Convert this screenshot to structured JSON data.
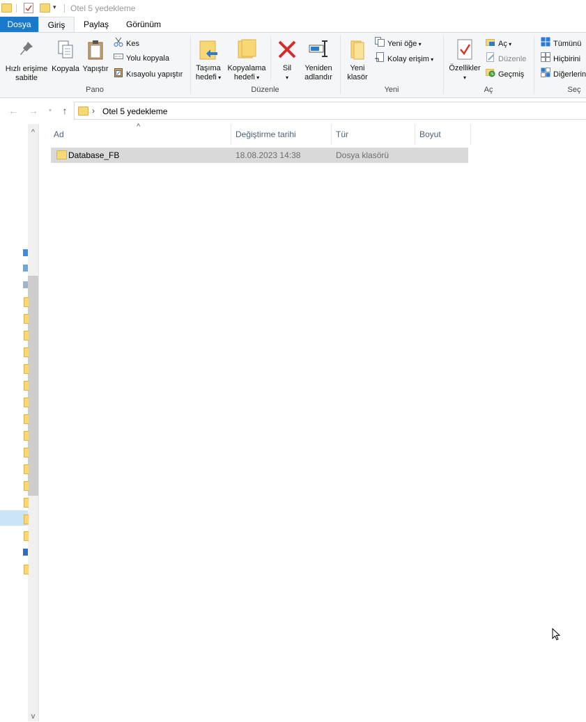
{
  "window": {
    "title": "Otel 5 yedekleme"
  },
  "tabs": [
    "Dosya",
    "Giriş",
    "Paylaş",
    "Görünüm"
  ],
  "ribbon": {
    "pano": {
      "label": "Pano",
      "pin_line1": "Hızlı erişime",
      "pin_line2": "sabitle",
      "copy": "Kopyala",
      "paste": "Yapıştır",
      "cut": "Kes",
      "copy_path": "Yolu kopyala",
      "paste_shortcut": "Kısayolu yapıştır"
    },
    "duzenle": {
      "label": "Düzenle",
      "move_line1": "Taşıma",
      "move_line2": "hedefi",
      "copyto_line1": "Kopyalama",
      "copyto_line2": "hedefi",
      "delete": "Sil",
      "rename_line1": "Yeniden",
      "rename_line2": "adlandır"
    },
    "yeni": {
      "label": "Yeni",
      "new_folder_line1": "Yeni",
      "new_folder_line2": "klasör",
      "new_item": "Yeni öğe",
      "easy_access": "Kolay erişim"
    },
    "ac": {
      "label": "Aç",
      "properties": "Özellikler",
      "open": "Aç",
      "edit": "Düzenle",
      "history": "Geçmiş"
    },
    "sec": {
      "label": "Seç",
      "select_all": "Tümünü",
      "select_none": "Hiçbirini",
      "invert": "Diğerlerini"
    }
  },
  "address": {
    "path": "Otel 5 yedekleme"
  },
  "columns": [
    "Ad",
    "Değiştirme tarihi",
    "Tür",
    "Boyut"
  ],
  "files": [
    {
      "name": "Database_FB",
      "modified": "18.08.2023 14:38",
      "type": "Dosya klasörü",
      "size": ""
    }
  ],
  "colors": {
    "accent": "#1979ca",
    "selected_row": "#d9d9d9",
    "folder": "#f8d775"
  }
}
